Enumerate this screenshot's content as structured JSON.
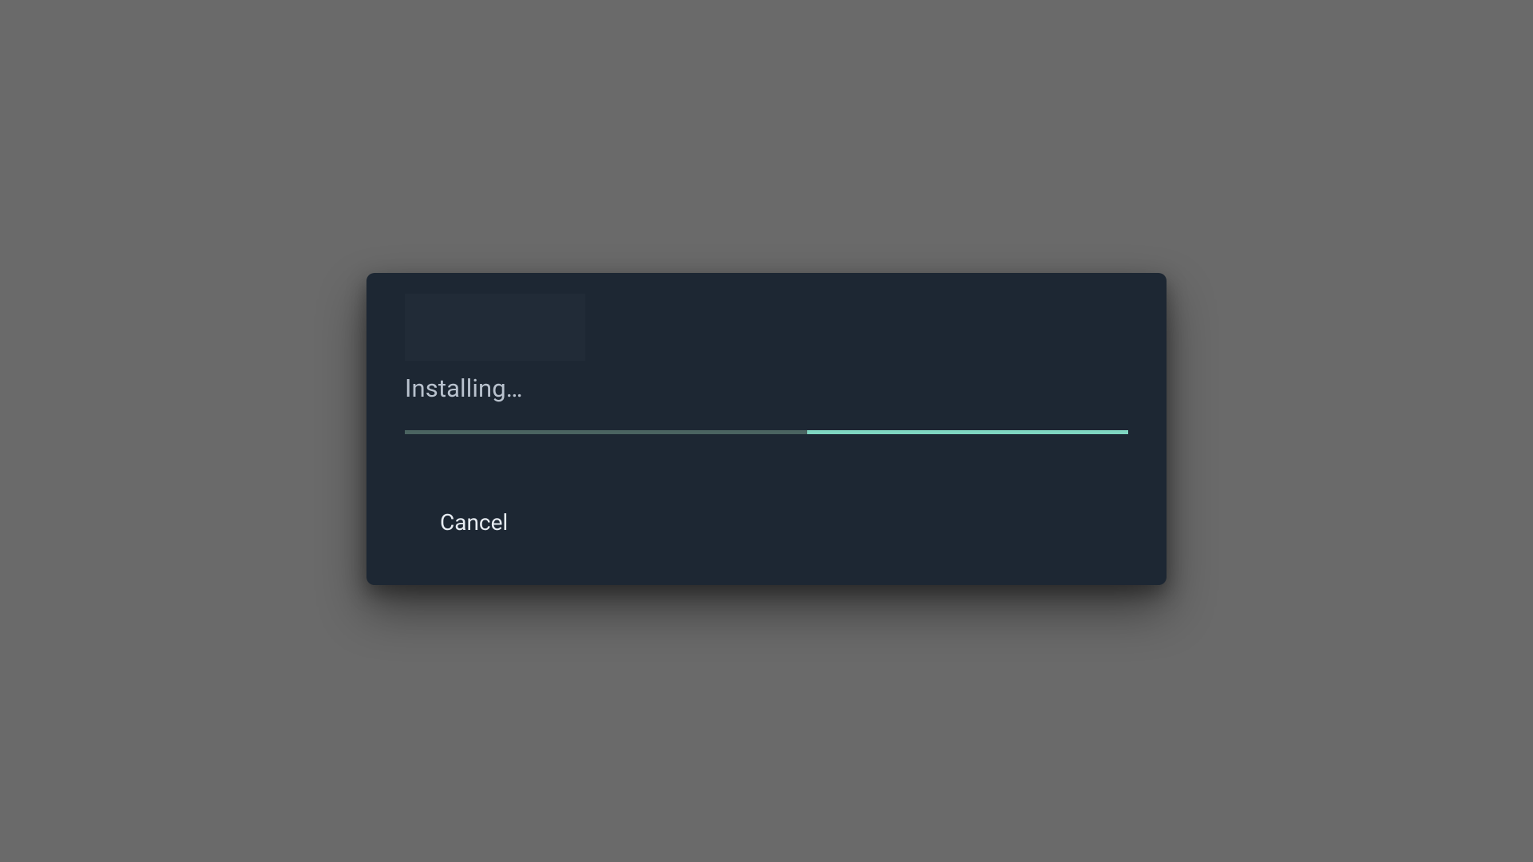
{
  "dialog": {
    "status_text": "Installing…",
    "cancel_label": "Cancel",
    "progress": {
      "indeterminate": true
    },
    "colors": {
      "dialog_bg": "#1d2733",
      "backdrop": "#6a6a6a",
      "progress_track": "#4b6461",
      "progress_fill": "#7fd5c1",
      "text_primary": "#e7ecf2",
      "text_secondary": "#b9c2ce"
    }
  }
}
